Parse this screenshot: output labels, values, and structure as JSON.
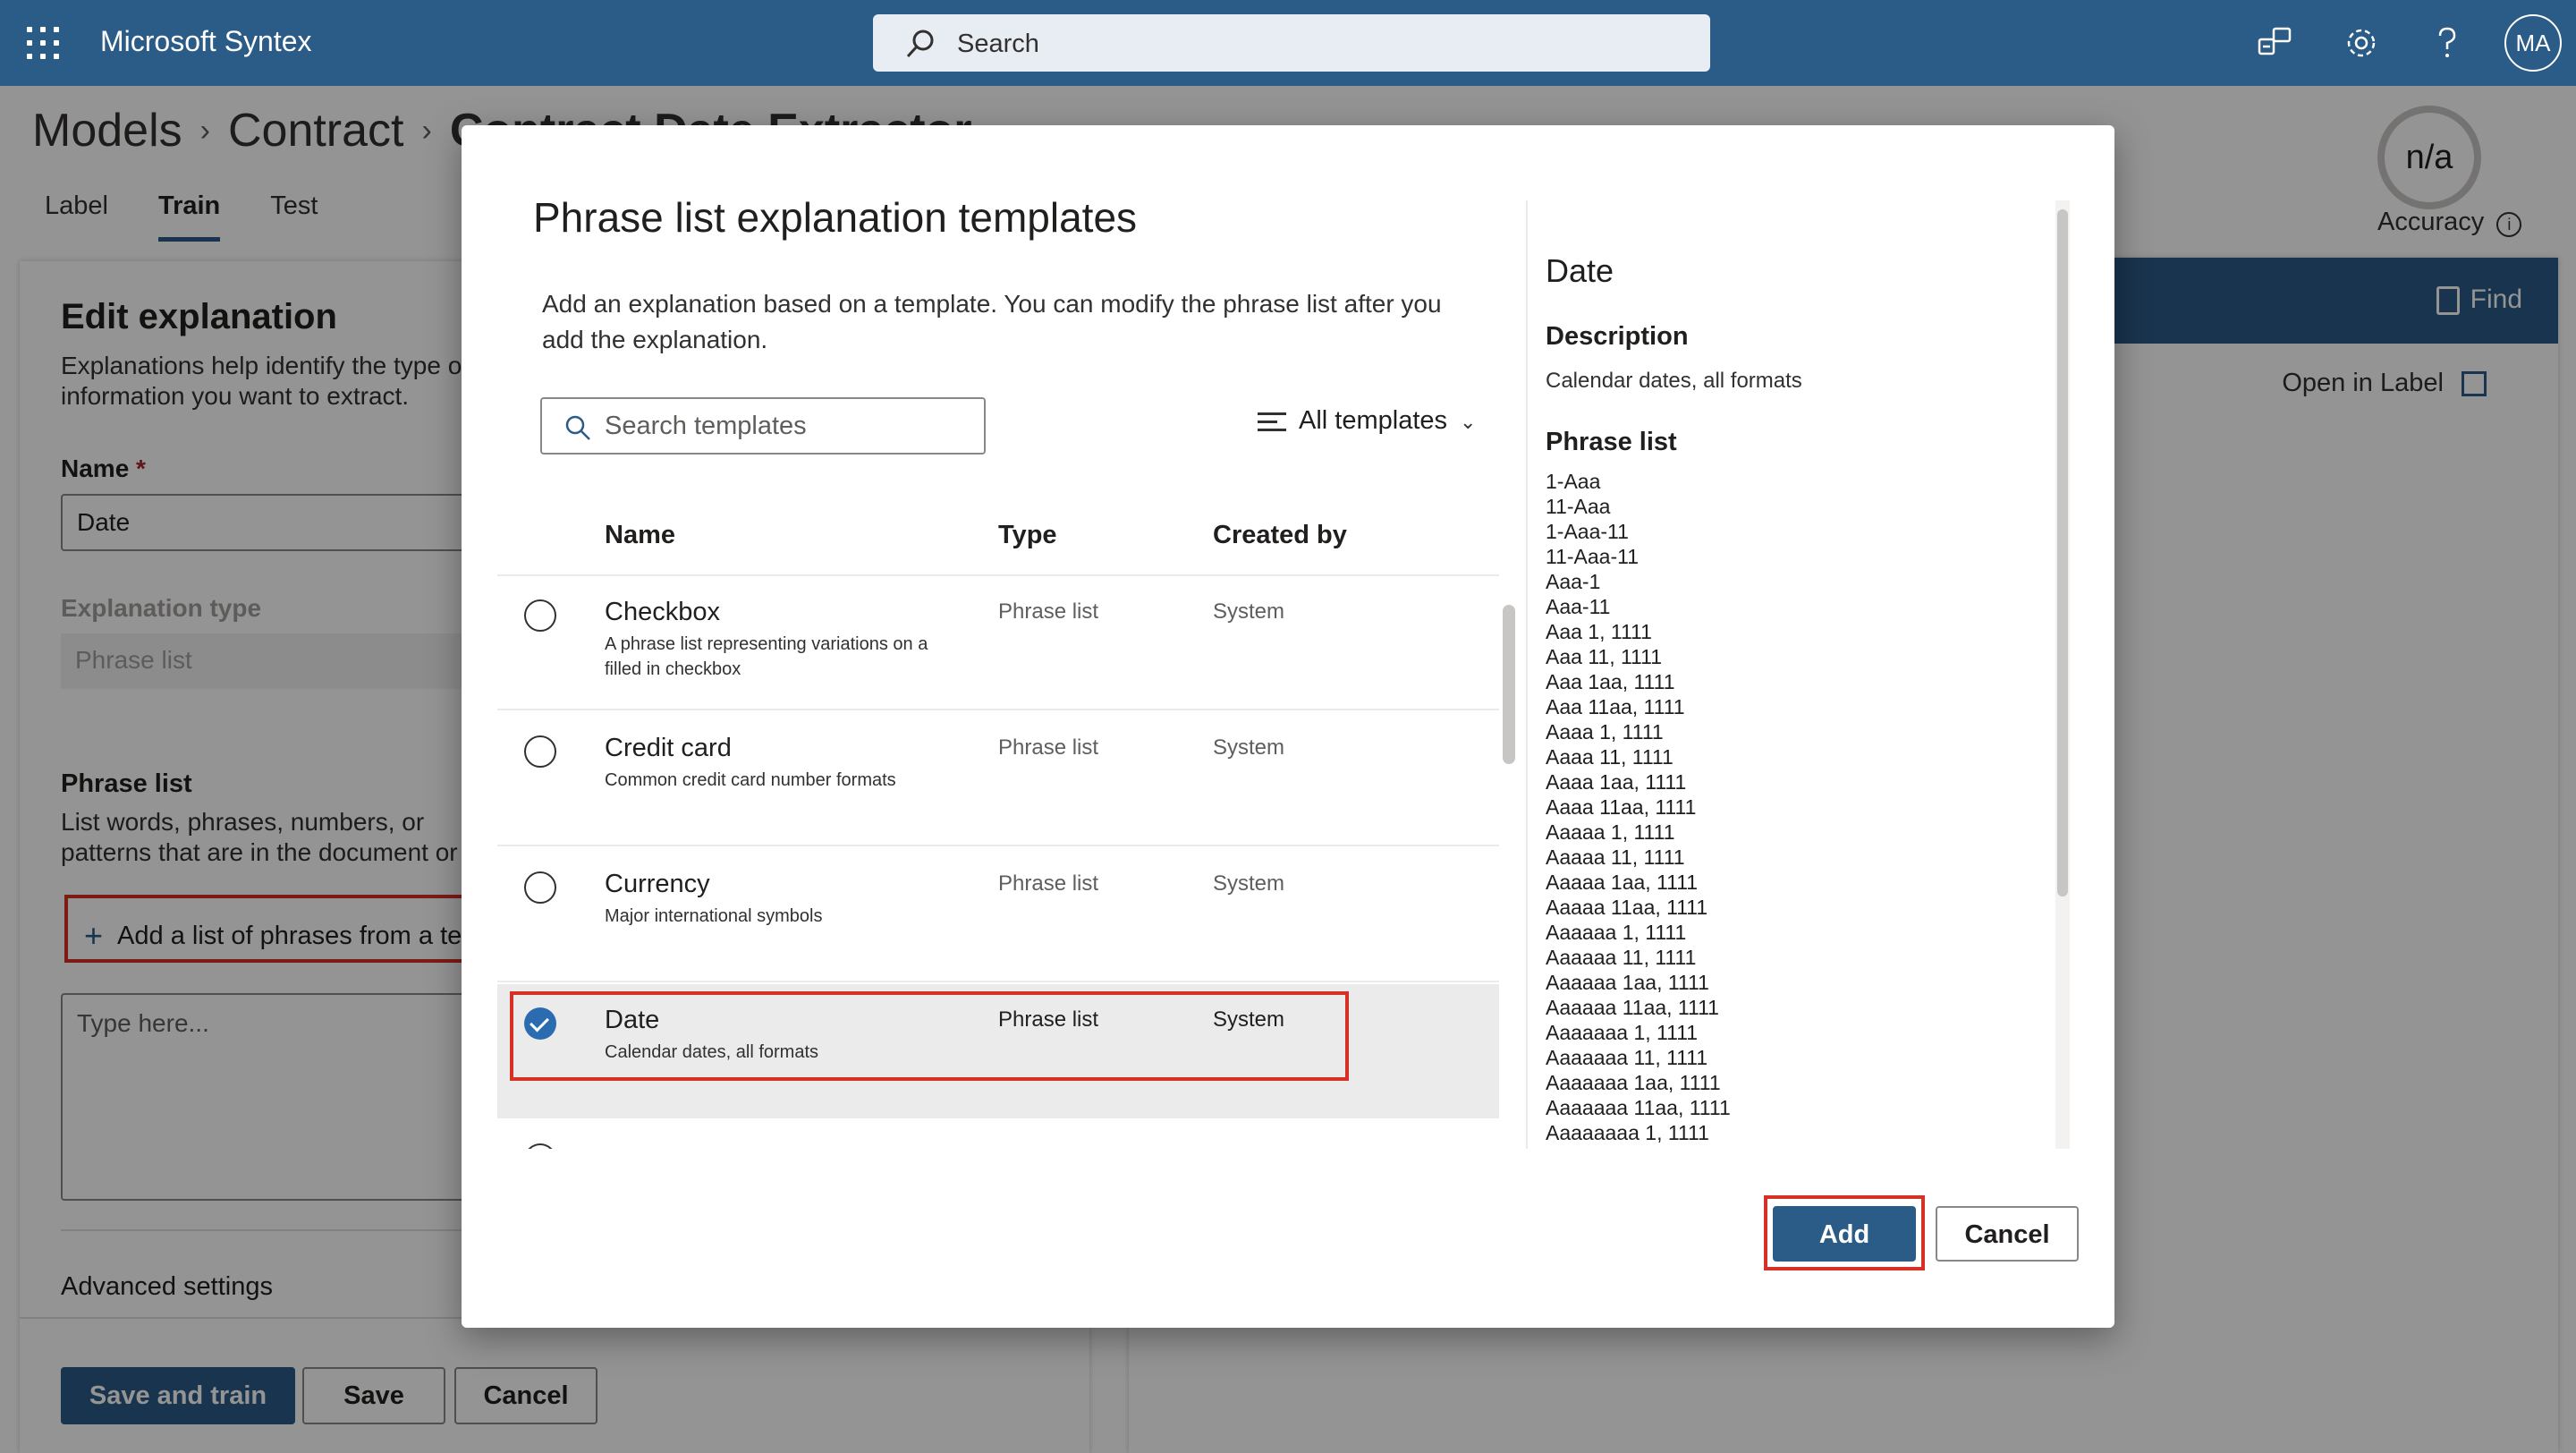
{
  "app": {
    "title": "Microsoft Syntex",
    "search_placeholder": "Search",
    "avatar_initials": "MA"
  },
  "breadcrumb": {
    "items": [
      "Models",
      "Contract",
      "Contract Date Extractor"
    ]
  },
  "tabs": [
    "Label",
    "Train",
    "Test"
  ],
  "active_tab": "Train",
  "accuracy": {
    "value": "n/a",
    "label": "Accuracy"
  },
  "right_panel": {
    "find_label": "Find",
    "open_in_label": "Open in Label"
  },
  "edit_panel": {
    "title": "Edit explanation",
    "description": "Explanations help identify the type of information you want to extract.",
    "name_label": "Name",
    "name_required": "*",
    "name_value": "Date",
    "type_label": "Explanation type",
    "type_value": "Phrase list",
    "phrase_label": "Phrase list",
    "phrase_desc": "List words, phrases, numbers, or patterns that are in the document or information you are trying to extract.",
    "add_list_label": "Add a list of phrases from a template",
    "textarea_placeholder": "Type here...",
    "advanced_label": "Advanced settings",
    "save_train_label": "Save and train",
    "save_label": "Save",
    "cancel_label": "Cancel"
  },
  "modal": {
    "title": "Phrase list explanation templates",
    "description": "Add an explanation based on a template. You can modify the phrase list after you add the explanation.",
    "search_placeholder": "Search templates",
    "filter_label": "All templates",
    "columns": {
      "name": "Name",
      "type": "Type",
      "created_by": "Created by"
    },
    "rows": [
      {
        "name": "Checkbox",
        "subtitle": "A phrase list representing variations on a filled in checkbox",
        "type": "Phrase list",
        "created_by": "System",
        "selected": false
      },
      {
        "name": "Credit card",
        "subtitle": "Common credit card number formats",
        "type": "Phrase list",
        "created_by": "System",
        "selected": false
      },
      {
        "name": "Currency",
        "subtitle": "Major international symbols",
        "type": "Phrase list",
        "created_by": "System",
        "selected": false
      },
      {
        "name": "Date",
        "subtitle": "Calendar dates, all formats",
        "type": "Phrase list",
        "created_by": "System",
        "selected": true
      }
    ],
    "detail": {
      "title": "Date",
      "description_heading": "Description",
      "description": "Calendar dates, all formats",
      "phrase_list_heading": "Phrase list",
      "phrases": [
        "1-Aaa",
        "11-Aaa",
        "1-Aaa-11",
        "11-Aaa-11",
        "Aaa-1",
        "Aaa-11",
        "Aaa 1, 1111",
        "Aaa 11, 1111",
        "Aaa 1aa, 1111",
        "Aaa 11aa, 1111",
        "Aaaa 1, 1111",
        "Aaaa 11, 1111",
        "Aaaa 1aa, 1111",
        "Aaaa 11aa, 1111",
        "Aaaaa 1, 1111",
        "Aaaaa 11, 1111",
        "Aaaaa 1aa, 1111",
        "Aaaaa 11aa, 1111",
        "Aaaaaa 1, 1111",
        "Aaaaaa 11, 1111",
        "Aaaaaa 1aa, 1111",
        "Aaaaaa 11aa, 1111",
        "Aaaaaaa 1, 1111",
        "Aaaaaaa 11, 1111",
        "Aaaaaaa 1aa, 1111",
        "Aaaaaaa 11aa, 1111",
        "Aaaaaaaa 1, 1111"
      ]
    },
    "add_label": "Add",
    "cancel_label": "Cancel"
  },
  "colors": {
    "brand": "#2b5b87",
    "highlight": "#d93025",
    "selected_row": "#ebebeb"
  }
}
